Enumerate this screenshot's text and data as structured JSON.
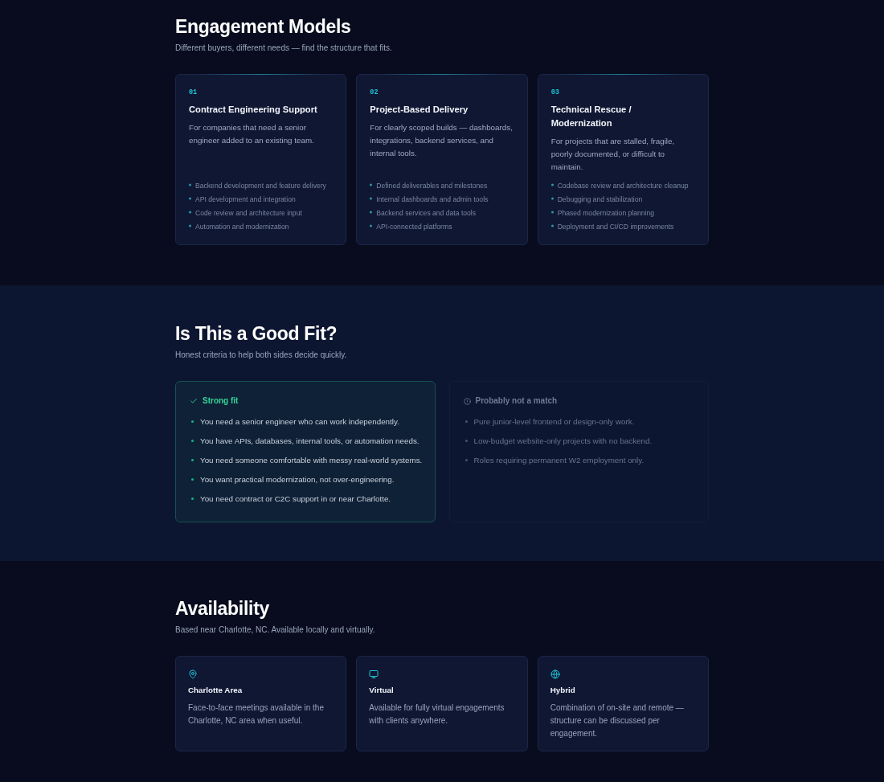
{
  "engagement_models": {
    "title": "Engagement Models",
    "subtitle": "Different buyers, different needs — find the structure that fits.",
    "cards": [
      {
        "number": "01",
        "title": "Contract Engineering Support",
        "description": "For companies that need a senior engineer added to an existing team.",
        "items": [
          "Backend development and feature delivery",
          "API development and integration",
          "Code review and architecture input",
          "Automation and modernization"
        ]
      },
      {
        "number": "02",
        "title": "Project-Based Delivery",
        "description": "For clearly scoped builds — dashboards, integrations, backend services, and internal tools.",
        "items": [
          "Defined deliverables and milestones",
          "Internal dashboards and admin tools",
          "Backend services and data tools",
          "API-connected platforms"
        ]
      },
      {
        "number": "03",
        "title": "Technical Rescue / Modernization",
        "description": "For projects that are stalled, fragile, poorly documented, or difficult to maintain.",
        "items": [
          "Codebase review and architecture cleanup",
          "Debugging and stabilization",
          "Phased modernization planning",
          "Deployment and CI/CD improvements"
        ]
      }
    ]
  },
  "good_fit": {
    "title": "Is This a Good Fit?",
    "subtitle": "Honest criteria to help both sides decide quickly.",
    "columns": [
      {
        "kind": "strong",
        "heading": "Strong fit",
        "items": [
          "You need a senior engineer who can work independently.",
          "You have APIs, databases, internal tools, or automation needs.",
          "You need someone comfortable with messy real-world systems.",
          "You want practical modernization, not over-engineering.",
          "You need contract or C2C support in or near Charlotte."
        ]
      },
      {
        "kind": "weak",
        "heading": "Probably not a match",
        "items": [
          "Pure junior-level frontend or design-only work.",
          "Low-budget website-only projects with no backend.",
          "Roles requiring permanent W2 employment only."
        ]
      }
    ]
  },
  "availability": {
    "title": "Availability",
    "subtitle": "Based near Charlotte, NC. Available locally and virtually.",
    "cards": [
      {
        "title": "Charlotte Area",
        "description": "Face-to-face meetings available in the Charlotte, NC area when useful."
      },
      {
        "title": "Virtual",
        "description": "Available for fully virtual engagements with clients anywhere."
      },
      {
        "title": "Hybrid",
        "description": "Combination of on-site and remote — structure can be discussed per engagement."
      }
    ]
  }
}
